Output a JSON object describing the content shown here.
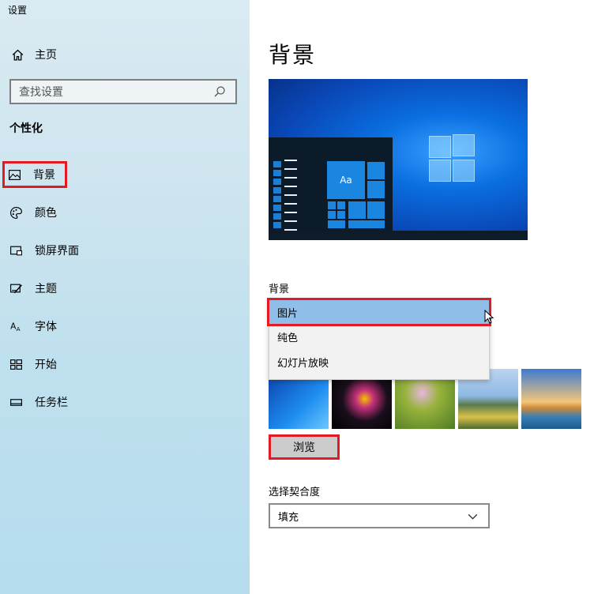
{
  "app": {
    "title": "设置"
  },
  "sidebar": {
    "home_label": "主页",
    "search_placeholder": "查找设置",
    "section_title": "个性化",
    "items": [
      {
        "label": "背景",
        "icon": "picture-icon"
      },
      {
        "label": "颜色",
        "icon": "palette-icon"
      },
      {
        "label": "锁屏界面",
        "icon": "lock-screen-icon"
      },
      {
        "label": "主题",
        "icon": "theme-icon"
      },
      {
        "label": "字体",
        "icon": "font-icon"
      },
      {
        "label": "开始",
        "icon": "start-icon"
      },
      {
        "label": "任务栏",
        "icon": "taskbar-icon"
      }
    ]
  },
  "main": {
    "title": "背景",
    "preview": {
      "tile_text": "Aa"
    },
    "background_label": "背景",
    "background_dropdown": {
      "options": [
        "图片",
        "纯色",
        "幻灯片放映"
      ],
      "selected": "图片"
    },
    "browse_label": "浏览",
    "fit_label": "选择契合度",
    "fit_value": "填充"
  },
  "colors": {
    "highlight_border": "#e01b24",
    "selected_option_bg": "#8fbfe9",
    "accent_blue": "#1a86e0"
  }
}
